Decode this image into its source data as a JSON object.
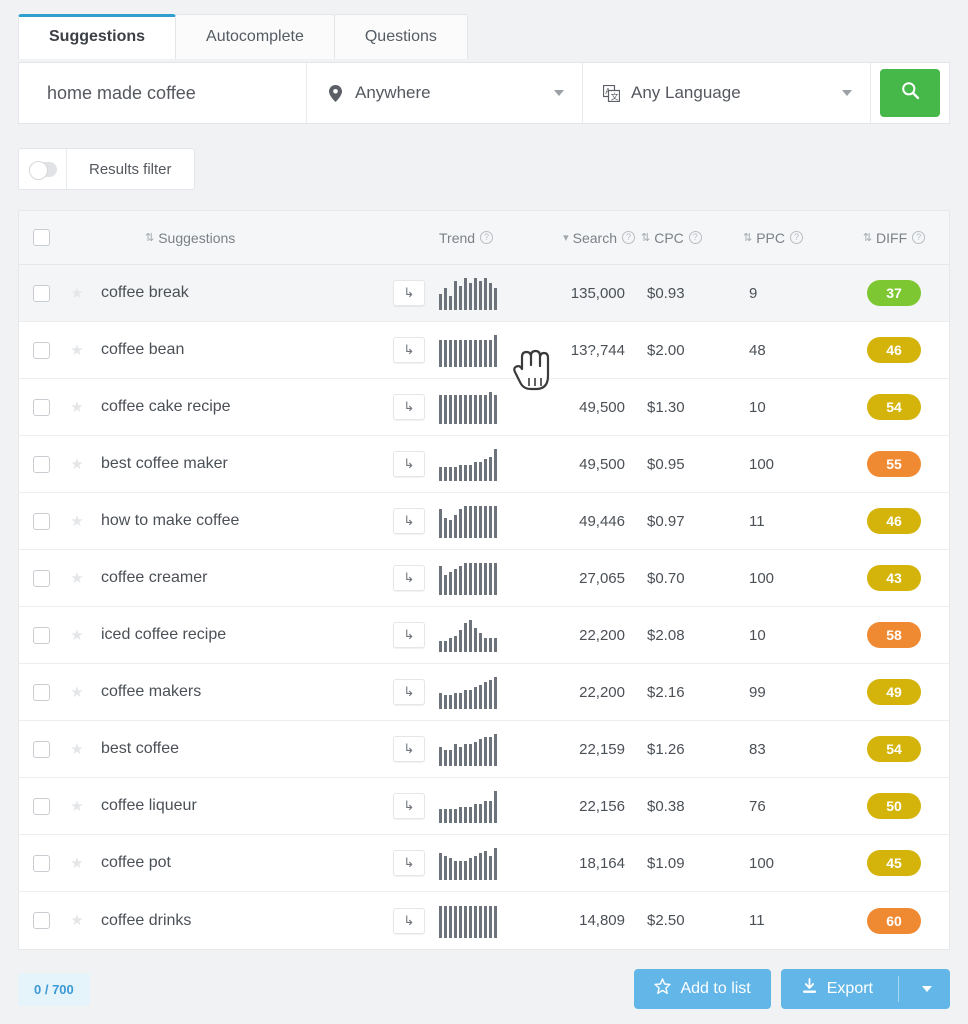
{
  "tabs": [
    {
      "label": "Suggestions",
      "active": true
    },
    {
      "label": "Autocomplete",
      "active": false
    },
    {
      "label": "Questions",
      "active": false
    }
  ],
  "search": {
    "query": "home made coffee",
    "location": "Anywhere",
    "location_icon": "map-pin-icon",
    "language": "Any Language",
    "language_icon": "language-icon",
    "submit_icon": "search-icon",
    "submit_color": "#46b749"
  },
  "filter": {
    "label": "Results filter",
    "toggle_on": false
  },
  "table": {
    "columns": [
      {
        "key": "check",
        "label": "",
        "sort": "none"
      },
      {
        "key": "sug",
        "label": "Suggestions",
        "sort": "both",
        "help": false
      },
      {
        "key": "trend",
        "label": "Trend",
        "sort": "none",
        "help": true
      },
      {
        "key": "search",
        "label": "Search",
        "sort": "desc",
        "help": true
      },
      {
        "key": "cpc",
        "label": "CPC",
        "sort": "both",
        "help": true
      },
      {
        "key": "ppc",
        "label": "PPC",
        "sort": "both",
        "help": true
      },
      {
        "key": "diff",
        "label": "DIFF",
        "sort": "both",
        "help": true
      }
    ],
    "rows": [
      {
        "keyword": "coffee break",
        "search": "135,000",
        "cpc": "$0.93",
        "ppc": "9",
        "diff": "37",
        "diff_color": "#7dc832",
        "highlight": true,
        "trend": [
          4,
          6,
          3,
          9,
          7,
          10,
          8,
          10,
          9,
          10,
          8,
          6
        ]
      },
      {
        "keyword": "coffee bean",
        "search": "13?,744",
        "cpc": "$2.00",
        "ppc": "48",
        "diff": "46",
        "diff_color": "#d4b40a",
        "highlight": false,
        "trend": [
          8,
          8,
          8,
          8,
          8,
          8,
          8,
          8,
          8,
          8,
          8,
          10
        ]
      },
      {
        "keyword": "coffee cake recipe",
        "search": "49,500",
        "cpc": "$1.30",
        "ppc": "10",
        "diff": "54",
        "diff_color": "#d4b40a",
        "highlight": false,
        "trend": [
          9,
          9,
          9,
          9,
          9,
          9,
          9,
          9,
          9,
          9,
          10,
          9
        ]
      },
      {
        "keyword": "best coffee maker",
        "search": "49,500",
        "cpc": "$0.95",
        "ppc": "100",
        "diff": "55",
        "diff_color": "#f08a32",
        "highlight": false,
        "trend": [
          3,
          3,
          3,
          3,
          4,
          4,
          4,
          5,
          5,
          6,
          7,
          10
        ]
      },
      {
        "keyword": "how to make coffee",
        "search": "49,446",
        "cpc": "$0.97",
        "ppc": "11",
        "diff": "46",
        "diff_color": "#d4b40a",
        "highlight": false,
        "trend": [
          8,
          5,
          4,
          6,
          8,
          9,
          9,
          9,
          9,
          9,
          9,
          9
        ]
      },
      {
        "keyword": "coffee creamer",
        "search": "27,065",
        "cpc": "$0.70",
        "ppc": "100",
        "diff": "43",
        "diff_color": "#d4b40a",
        "highlight": false,
        "trend": [
          8,
          5,
          6,
          7,
          8,
          9,
          9,
          9,
          9,
          9,
          9,
          9
        ]
      },
      {
        "keyword": "iced coffee recipe",
        "search": "22,200",
        "cpc": "$2.08",
        "ppc": "10",
        "diff": "58",
        "diff_color": "#f08a32",
        "highlight": false,
        "trend": [
          2,
          2,
          3,
          4,
          6,
          9,
          10,
          7,
          5,
          3,
          3,
          3
        ]
      },
      {
        "keyword": "coffee makers",
        "search": "22,200",
        "cpc": "$2.16",
        "ppc": "99",
        "diff": "49",
        "diff_color": "#d4b40a",
        "highlight": false,
        "trend": [
          4,
          3,
          3,
          4,
          4,
          5,
          5,
          6,
          7,
          8,
          9,
          10
        ]
      },
      {
        "keyword": "best coffee",
        "search": "22,159",
        "cpc": "$1.26",
        "ppc": "83",
        "diff": "54",
        "diff_color": "#d4b40a",
        "highlight": false,
        "trend": [
          5,
          4,
          4,
          6,
          5,
          6,
          6,
          7,
          8,
          9,
          9,
          10
        ]
      },
      {
        "keyword": "coffee liqueur",
        "search": "22,156",
        "cpc": "$0.38",
        "ppc": "76",
        "diff": "50",
        "diff_color": "#d4b40a",
        "highlight": false,
        "trend": [
          3,
          3,
          3,
          3,
          4,
          4,
          4,
          5,
          5,
          6,
          6,
          10
        ]
      },
      {
        "keyword": "coffee pot",
        "search": "18,164",
        "cpc": "$1.09",
        "ppc": "100",
        "diff": "45",
        "diff_color": "#d4b40a",
        "highlight": false,
        "trend": [
          8,
          7,
          6,
          5,
          5,
          5,
          6,
          7,
          8,
          9,
          7,
          10
        ]
      },
      {
        "keyword": "coffee drinks",
        "search": "14,809",
        "cpc": "$2.50",
        "ppc": "11",
        "diff": "60",
        "diff_color": "#f08a32",
        "highlight": false,
        "trend": [
          9,
          9,
          9,
          9,
          9,
          9,
          9,
          9,
          9,
          9,
          9,
          9
        ]
      }
    ],
    "row_arrow_glyph": "↳",
    "star_glyph": "★"
  },
  "footer": {
    "counter": "0 / 700",
    "add_to_list": "Add to list",
    "add_icon": "star-outline-icon",
    "export": "Export",
    "export_icon": "download-icon",
    "button_color": "#62b6e8"
  }
}
